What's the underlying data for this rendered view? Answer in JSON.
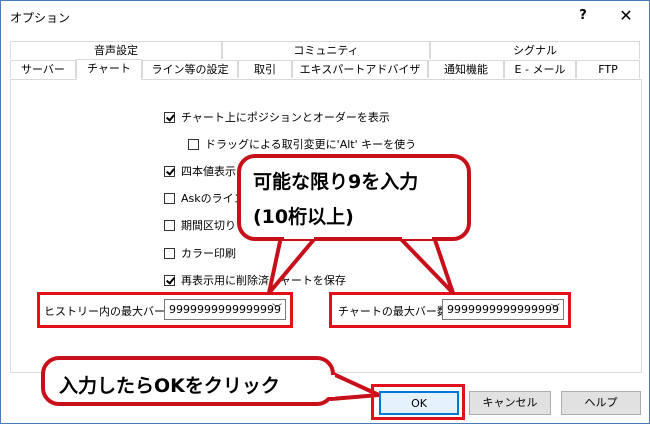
{
  "window": {
    "title": "オプション",
    "help_glyph": "?",
    "close_glyph": "✕"
  },
  "tabs_top": [
    "音声設定",
    "コミュニティ",
    "シグナル"
  ],
  "tabs_bottom": [
    "サーバー",
    "チャート",
    "ライン等の設定",
    "取引",
    "エキスパートアドバイザ",
    "通知機能",
    "E - メール",
    "FTP"
  ],
  "active_tab": "チャート",
  "checkboxes": [
    {
      "label": "チャート上にポジションとオーダーを表示",
      "checked": true
    },
    {
      "label": "ドラッグによる取引変更に'Alt' キーを使う",
      "checked": false
    },
    {
      "label": "四本値表示",
      "checked": true
    },
    {
      "label": "Askのライン",
      "checked": false
    },
    {
      "label": "期間区切り",
      "checked": false
    },
    {
      "label": "カラー印刷",
      "checked": false
    },
    {
      "label": "再表示用に削除済チャートを保存",
      "checked": true
    }
  ],
  "history_max_bars": {
    "label": "ヒストリー内の最大バー数",
    "value": "9999999999999999"
  },
  "chart_max_bars": {
    "label": "チャートの最大バー数：",
    "value": "9999999999999999"
  },
  "buttons": {
    "ok": "OK",
    "cancel": "キャンセル",
    "help": "ヘルプ"
  },
  "callouts": {
    "input_line1": "可能な限り9を入力",
    "input_line2": "(10桁以上)",
    "click_ok": "入力したらOKをクリック"
  },
  "colors": {
    "highlight_red": "#e0101c",
    "primary_blue": "#0078d7"
  }
}
